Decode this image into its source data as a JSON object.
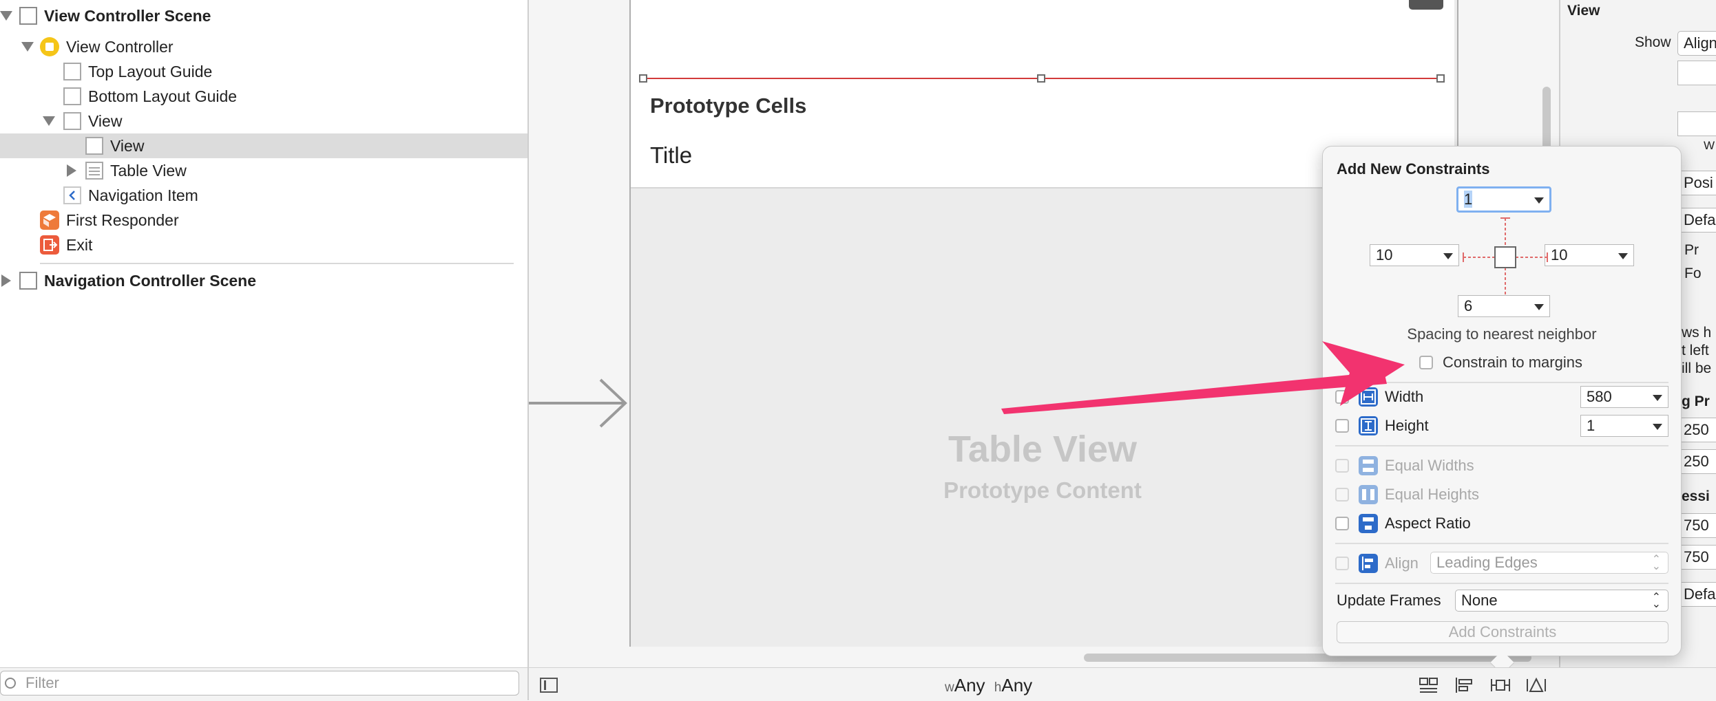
{
  "outline": {
    "items": [
      {
        "label": "View Controller Scene"
      },
      {
        "label": "View Controller"
      },
      {
        "label": "Top Layout Guide"
      },
      {
        "label": "Bottom Layout Guide"
      },
      {
        "label": "View"
      },
      {
        "label": "View"
      },
      {
        "label": "Table View"
      },
      {
        "label": "Navigation Item"
      },
      {
        "label": "First Responder"
      },
      {
        "label": "Exit"
      },
      {
        "label": "Navigation Controller Scene"
      }
    ],
    "filter_placeholder": "Filter"
  },
  "canvas": {
    "section_header": "Prototype Cells",
    "cell_title": "Title",
    "table_view_label": "Table View",
    "table_view_sublabel": "Prototype Content"
  },
  "popover": {
    "title": "Add New Constraints",
    "top_value": "1",
    "left_value": "10",
    "right_value": "10",
    "bottom_value": "6",
    "spacing_caption": "Spacing to nearest neighbor",
    "constrain_margins_label": "Constrain to margins",
    "width_label": "Width",
    "width_value": "580",
    "height_label": "Height",
    "height_value": "1",
    "equal_widths_label": "Equal Widths",
    "equal_heights_label": "Equal Heights",
    "aspect_ratio_label": "Aspect Ratio",
    "align_label": "Align",
    "align_value": "Leading Edges",
    "update_frames_label": "Update Frames",
    "update_frames_value": "None",
    "add_button_label": "Add Constraints"
  },
  "inspector": {
    "section": "View",
    "show_label": "Show",
    "show_value": "Align",
    "w_label": "W",
    "rows": [
      "Posi",
      "Defa",
      "Pr",
      "Fo",
      "ws h",
      "t left",
      "ill be",
      "g Pr",
      "250",
      "250",
      "essi",
      "750",
      "750",
      "Defa"
    ]
  },
  "bottom_bar": {
    "w_prefix": "w",
    "w_value": "Any",
    "h_prefix": "h",
    "h_value": "Any"
  },
  "colors": {
    "arrow": "#f2336f",
    "constraint_red": "#d23a3a",
    "selection": "#dcdcdc",
    "accent_blue": "#2d6bc9"
  }
}
